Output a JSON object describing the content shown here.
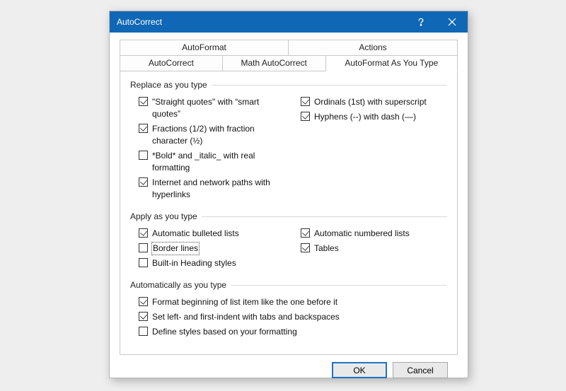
{
  "titlebar": {
    "title": "AutoCorrect"
  },
  "tabs": {
    "row1": [
      "AutoFormat",
      "Actions"
    ],
    "row2": [
      "AutoCorrect",
      "Math AutoCorrect",
      "AutoFormat As You Type"
    ]
  },
  "groups": {
    "replace": {
      "header": "Replace as you type",
      "left": [
        {
          "checked": true,
          "label": "\"Straight quotes\" with “smart quotes”"
        },
        {
          "checked": true,
          "label": "Fractions (1/2) with fraction character (½)"
        },
        {
          "checked": false,
          "label": "*Bold* and _italic_ with real formatting"
        },
        {
          "checked": true,
          "label": "Internet and network paths with hyperlinks"
        }
      ],
      "right": [
        {
          "checked": true,
          "label": "Ordinals (1st) with superscript"
        },
        {
          "checked": true,
          "label": "Hyphens (--) with dash (—)"
        }
      ]
    },
    "apply": {
      "header": "Apply as you type",
      "left": [
        {
          "checked": true,
          "label": "Automatic bulleted lists"
        },
        {
          "checked": false,
          "label": "Border lines",
          "focused": true
        },
        {
          "checked": false,
          "label": "Built-in Heading styles"
        }
      ],
      "right": [
        {
          "checked": true,
          "label": "Automatic numbered lists"
        },
        {
          "checked": true,
          "label": "Tables"
        }
      ]
    },
    "auto": {
      "header": "Automatically as you type",
      "items": [
        {
          "checked": true,
          "label": "Format beginning of list item like the one before it"
        },
        {
          "checked": true,
          "label": "Set left- and first-indent with tabs and backspaces"
        },
        {
          "checked": false,
          "label": "Define styles based on your formatting"
        }
      ]
    }
  },
  "buttons": {
    "ok": "OK",
    "cancel": "Cancel"
  }
}
